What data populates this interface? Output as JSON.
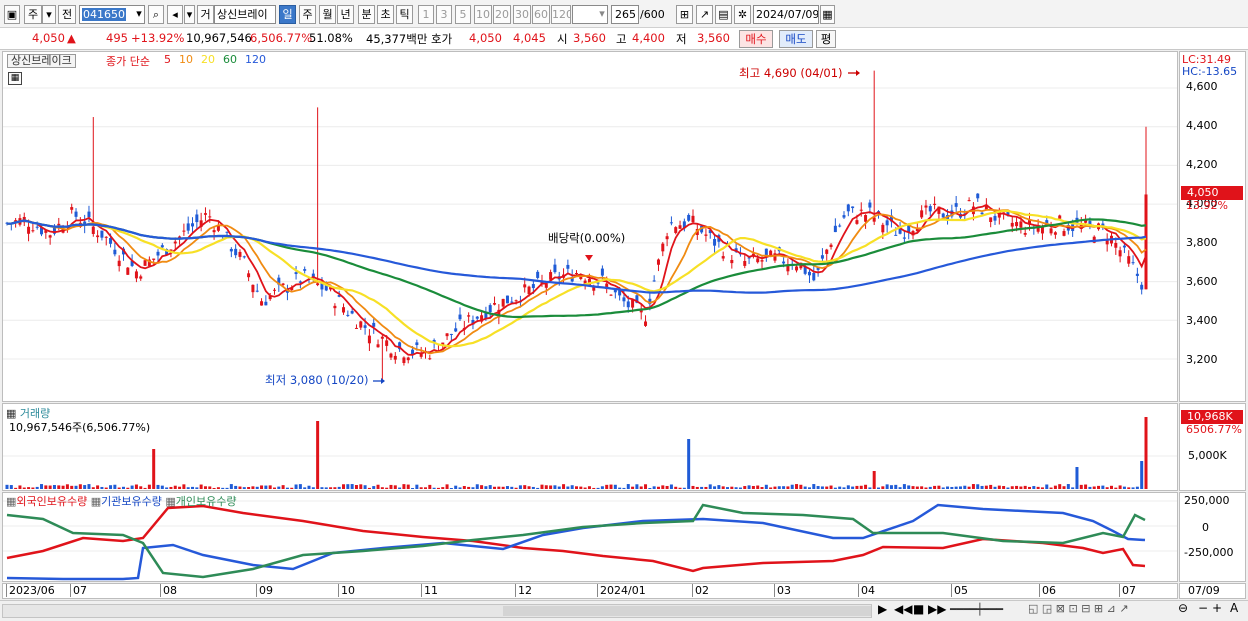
{
  "toolbar": {
    "mode1": "주",
    "mode2": "전",
    "code": "041650",
    "type_btn": "거",
    "stock_name": "상신브레이",
    "periods": [
      "일",
      "주",
      "월",
      "년",
      "분",
      "초",
      "틱"
    ],
    "active_period": "일",
    "intervals": [
      "1",
      "3",
      "5",
      "10",
      "20",
      "30",
      "60",
      "120"
    ],
    "count": "265",
    "count_max": "/600",
    "date": "2024/07/09"
  },
  "info_bar": {
    "price": "4,050",
    "change": "495",
    "change_pct": "+13.92%",
    "volume": "10,967,546",
    "volume_pct": "6,506.77%",
    "ratio": "51.08%",
    "amount": "45,377백만",
    "quote_label": "호가",
    "ask": "4,050",
    "bid": "4,045",
    "open_label": "시",
    "open": "3,560",
    "high_label": "고",
    "high": "4,400",
    "low_label": "저",
    "low": "3,560",
    "buy_label": "매수",
    "sell_label": "매도",
    "eval_label": "평"
  },
  "price_panel": {
    "title": "상신브레이크",
    "ma_label": "종가 단순",
    "ma_periods": [
      "5",
      "10",
      "20",
      "60",
      "120"
    ],
    "ma_colors": [
      "#e0131a",
      "#f08b12",
      "#f7e026",
      "#1a8c3a",
      "#2659d9"
    ],
    "lc": "LC:31.49",
    "hc": "HC:-13.65",
    "current_price": "4,050",
    "current_pct": "13.92%",
    "y_ticks": [
      "4,600",
      "4,400",
      "4,200",
      "4,000",
      "3,800",
      "3,600",
      "3,400",
      "3,200"
    ],
    "high_note": "최고 4,690 (04/01)",
    "low_note": "최저 3,080 (10/20)",
    "dividend_note": "배당락(0.00%)"
  },
  "volume_panel": {
    "title": "거래량",
    "value": "10,967,546주(6,506.77%)",
    "current": "10,968K",
    "current_pct": "6506.77%",
    "y_tick": "5,000K"
  },
  "holding_panel": {
    "legend": [
      "외국인보유수량",
      "기관보유수량",
      "개인보유수량"
    ],
    "colors": [
      "#e0131a",
      "#2659d9",
      "#2e8b57"
    ],
    "y_ticks": [
      "250,000",
      "0",
      "-250,000"
    ]
  },
  "x_axis": {
    "labels": [
      "2023/06",
      "07",
      "08",
      "09",
      "10",
      "11",
      "12",
      "2024/01",
      "02",
      "03",
      "04",
      "05",
      "06",
      "07"
    ],
    "end_label": "07/09"
  }
}
